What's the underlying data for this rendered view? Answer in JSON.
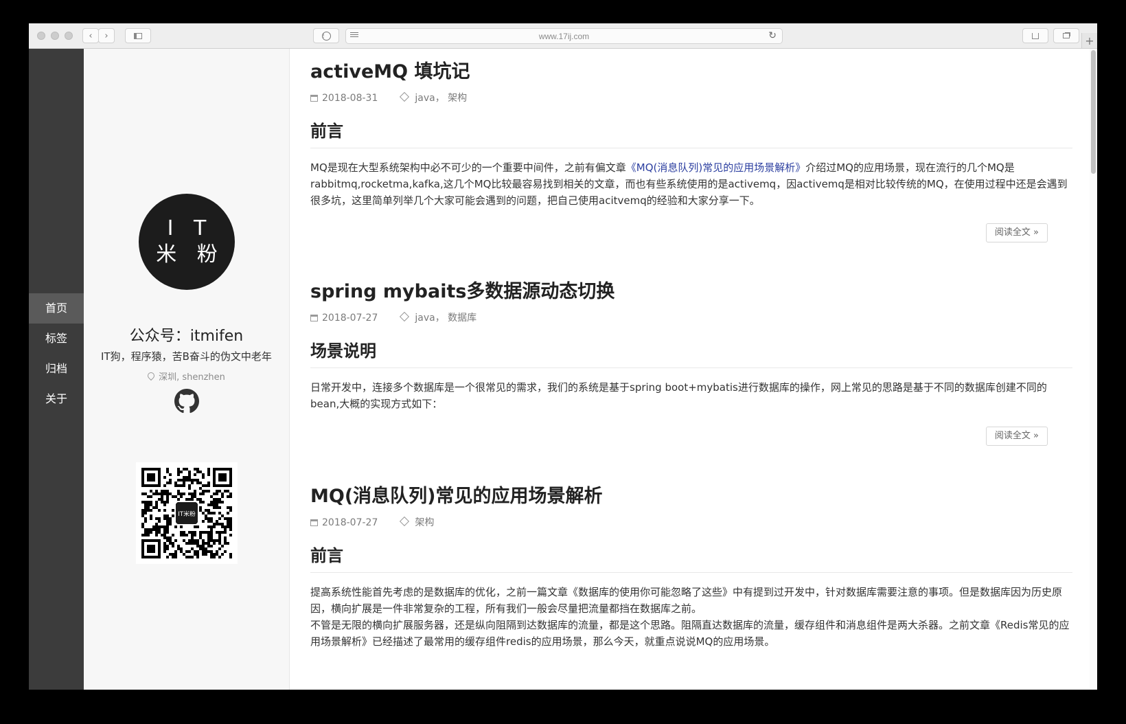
{
  "browser": {
    "url": "www.17ij.com",
    "new_tab": "+"
  },
  "nav": {
    "items": [
      {
        "label": "首页",
        "active": true
      },
      {
        "label": "标签",
        "active": false
      },
      {
        "label": "归档",
        "active": false
      },
      {
        "label": "关于",
        "active": false
      }
    ]
  },
  "profile": {
    "avatar_line1": "I T",
    "avatar_line2": "米 粉",
    "name": "公众号：itmifen",
    "bio": "IT狗，程序猿，苦B奋斗的伪文中老年",
    "location": "深圳, shenzhen",
    "qr_center_text": "IT米粉"
  },
  "posts": [
    {
      "title": "activeMQ 填坑记",
      "date": "2018-08-31",
      "tags": "java， 架构",
      "section": "前言",
      "excerpt_before": "MQ是现在大型系统架构中必不可少的一个重要中间件，之前有偏文章",
      "excerpt_link": "《MQ(消息队列)常见的应用场景解析》",
      "excerpt_after": "介绍过MQ的应用场景，现在流行的几个MQ是rabbitmq,rocketma,kafka,这几个MQ比较最容易找到相关的文章，而也有些系统使用的是activemq，因activemq是相对比较传统的MQ，在使用过程中还是会遇到很多坑，这里简单列举几个大家可能会遇到的问题，把自己使用acitvemq的经验和大家分享一下。",
      "more": "阅读全文 »"
    },
    {
      "title": "spring mybaits多数据源动态切换",
      "date": "2018-07-27",
      "tags": "java， 数据库",
      "section": "场景说明",
      "excerpt": "日常开发中，连接多个数据库是一个很常见的需求，我们的系统是基于spring boot+mybatis进行数据库的操作，网上常见的思路是基于不同的数据库创建不同的bean,大概的实现方式如下：",
      "more": "阅读全文 »"
    },
    {
      "title": "MQ(消息队列)常见的应用场景解析",
      "date": "2018-07-27",
      "tags": "架构",
      "section": "前言",
      "excerpt_p1": "提高系统性能首先考虑的是数据库的优化，之前一篇文章《数据库的使用你可能忽略了这些》中有提到过开发中，针对数据库需要注意的事项。但是数据库因为历史原因，横向扩展是一件非常复杂的工程，所有我们一般会尽量把流量都挡在数据库之前。",
      "excerpt_p2": "不管是无限的横向扩展服务器，还是纵向阻隔到达数据库的流量，都是这个思路。阻隔直达数据库的流量，缓存组件和消息组件是两大杀器。之前文章《Redis常见的应用场景解析》已经描述了最常用的缓存组件redis的应用场景，那么今天，就重点说说MQ的应用场景。"
    }
  ]
}
